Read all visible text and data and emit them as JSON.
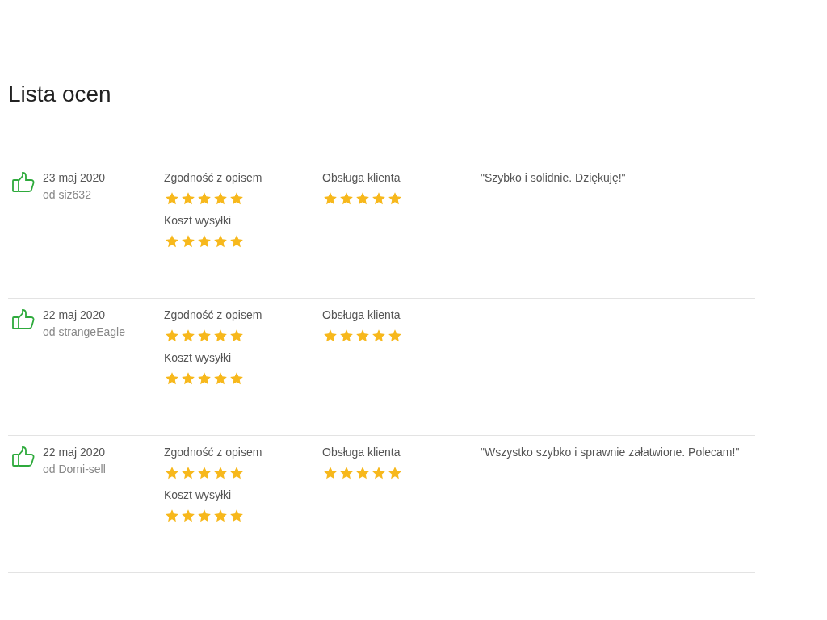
{
  "title": "Lista ocen",
  "reviews": [
    {
      "positive": true,
      "date": "23 maj 2020",
      "author": "od siz632",
      "columns": [
        [
          {
            "label": "Zgodność z opisem",
            "stars": 5
          },
          {
            "label": "Koszt wysyłki",
            "stars": 5
          }
        ],
        [
          {
            "label": "Obsługa klienta",
            "stars": 5
          }
        ]
      ],
      "comment": "\"Szybko i solidnie. Dziękuję!\""
    },
    {
      "positive": true,
      "date": "22 maj 2020",
      "author": "od strangeEagle",
      "columns": [
        [
          {
            "label": "Zgodność z opisem",
            "stars": 5
          },
          {
            "label": "Koszt wysyłki",
            "stars": 5
          }
        ],
        [
          {
            "label": "Obsługa klienta",
            "stars": 5
          }
        ]
      ]
    },
    {
      "positive": true,
      "date": "22 maj 2020",
      "author": "od Domi-sell",
      "columns": [
        [
          {
            "label": "Zgodność z opisem",
            "stars": 5
          },
          {
            "label": "Koszt wysyłki",
            "stars": 5
          }
        ],
        [
          {
            "label": "Obsługa klienta",
            "stars": 5
          }
        ]
      ],
      "comment": "\"Wszystko szybko i sprawnie załatwione. Polecam!\""
    }
  ]
}
